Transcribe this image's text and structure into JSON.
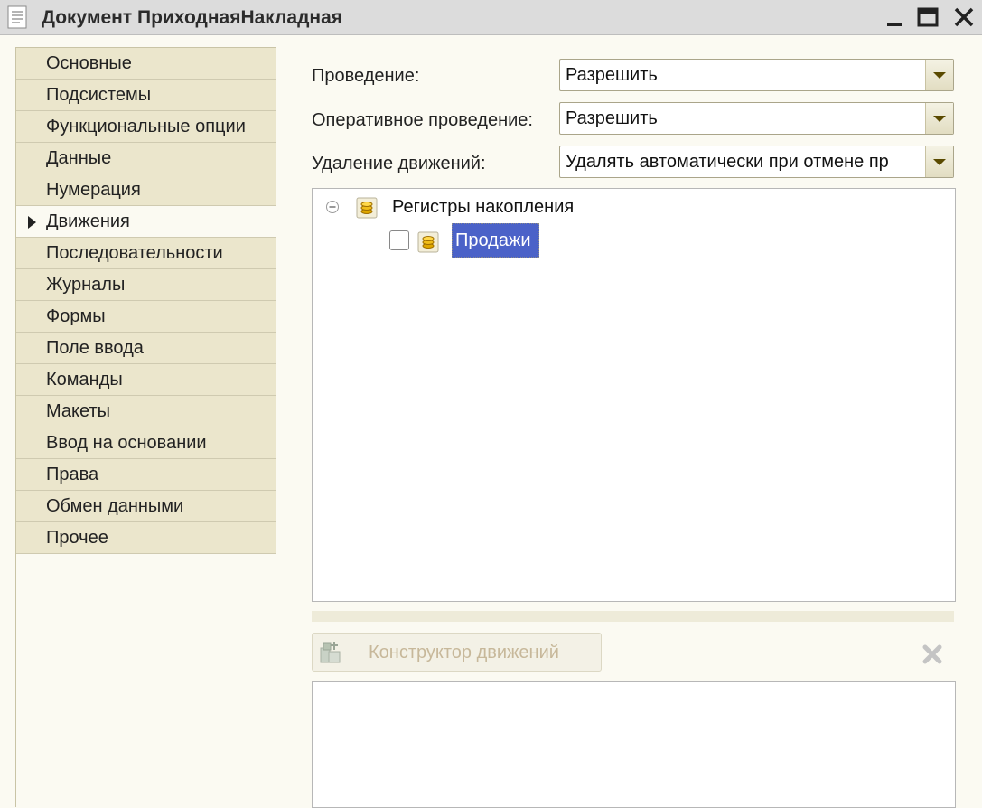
{
  "window": {
    "title": "Документ ПриходнаяНакладная",
    "icon": "document-icon",
    "controls": [
      "minimize-icon",
      "maximize-icon",
      "close-icon"
    ]
  },
  "nav": {
    "active_index": 5,
    "items": [
      {
        "label": "Основные"
      },
      {
        "label": "Подсистемы"
      },
      {
        "label": "Функциональные опции"
      },
      {
        "label": "Данные"
      },
      {
        "label": "Нумерация"
      },
      {
        "label": "Движения"
      },
      {
        "label": "Последовательности"
      },
      {
        "label": "Журналы"
      },
      {
        "label": "Формы"
      },
      {
        "label": "Поле ввода"
      },
      {
        "label": "Команды"
      },
      {
        "label": "Макеты"
      },
      {
        "label": "Ввод на основании"
      },
      {
        "label": "Права"
      },
      {
        "label": "Обмен данными"
      },
      {
        "label": "Прочее"
      }
    ]
  },
  "form": {
    "posting": {
      "label": "Проведение:",
      "value": "Разрешить"
    },
    "realtime_posting": {
      "label": "Оперативное проведение:",
      "value": "Разрешить"
    },
    "movements_deletion": {
      "label": "Удаление движений:",
      "value": "Удалять автоматически при отмене пр"
    }
  },
  "tree": {
    "group": {
      "label": "Регистры накопления",
      "expanded": true
    },
    "items": [
      {
        "label": "Продажи",
        "checked": false,
        "selected": true
      }
    ]
  },
  "toolbar": {
    "constructor_label": "Конструктор движений",
    "constructor_enabled": false,
    "delete_icon": "delete-icon"
  },
  "colors": {
    "nav_bg": "#ebe6cc",
    "selection": "#4b62c8",
    "window_bg": "#fbfaf2"
  }
}
